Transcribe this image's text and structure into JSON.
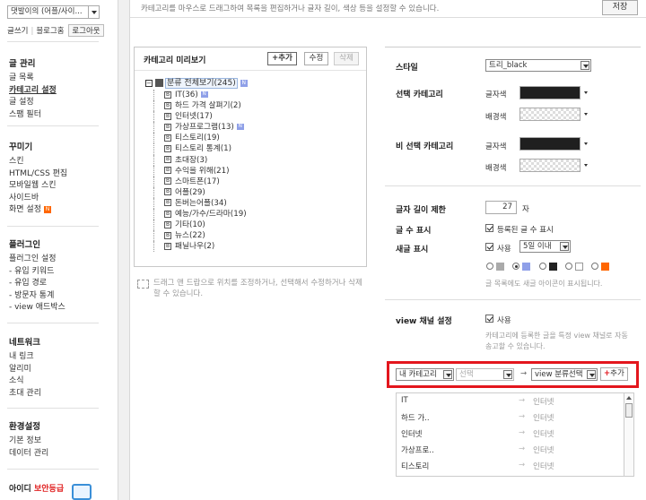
{
  "sidebar": {
    "blog_select": "댓발이의 (어플/사이...",
    "top_links": {
      "write": "글쓰기",
      "blog_home": "블로그홈",
      "logout": "로그아웃"
    },
    "sections": [
      {
        "heading": "글 관리",
        "items": [
          "글 목록",
          "카테고리 설정",
          "글 설정",
          "스팸 필터"
        ]
      },
      {
        "heading": "꾸미기",
        "items": [
          "스킨",
          "HTML/CSS 편집",
          "모바일웹 스킨",
          "사이드바",
          "화면 설정"
        ]
      },
      {
        "heading": "플러그인",
        "items": [
          "플러그인 설정",
          "- 유입 키워드",
          "- 유입 경로",
          "- 방문자 통계",
          "- view 애드박스"
        ]
      },
      {
        "heading": "네트워크",
        "items": [
          "내 링크",
          "알리미",
          "소식",
          "초대 관리"
        ]
      },
      {
        "heading": "환경설정",
        "items": [
          "기본 정보",
          "데이터 관리"
        ]
      }
    ],
    "new_badge": "N",
    "promo_prefix": "아이디 ",
    "promo_red": "보안등급"
  },
  "topbar": {
    "message": "카테고리를 마우스로 드래그하여 목록을 편집하거나 글자 길이, 색상 등을 설정할 수 있습니다.",
    "save": "저장"
  },
  "preview": {
    "title": "카테고리 미리보기",
    "add": "+추가",
    "edit": "수정",
    "delete": "삭제",
    "root": "분류 전체보기(245)",
    "items": [
      {
        "label": "IT(36)",
        "n": true
      },
      {
        "label": "하드 가격 살펴기(2)",
        "n": false
      },
      {
        "label": "인터넷(17)",
        "n": false
      },
      {
        "label": "가상프로그램(13)",
        "n": true
      },
      {
        "label": "티스토리(19)",
        "n": false
      },
      {
        "label": "티스토리 통계(1)",
        "n": false
      },
      {
        "label": "초대장(3)",
        "n": false
      },
      {
        "label": "수익을 위해(21)",
        "n": false
      },
      {
        "label": "스마트폰(17)",
        "n": false
      },
      {
        "label": "어플(29)",
        "n": false
      },
      {
        "label": "돈버는어플(34)",
        "n": false
      },
      {
        "label": "예능/가수/드라마(19)",
        "n": false
      },
      {
        "label": "기타(10)",
        "n": false
      },
      {
        "label": "뉴스(22)",
        "n": false
      },
      {
        "label": "패닐나우(2)",
        "n": false
      }
    ],
    "n_badge": "N",
    "help": "드래그 앤 드랍으로 위치를 조정하거나, 선택해서 수정하거나 삭제할 수 있습니다."
  },
  "settings": {
    "style_label": "스타일",
    "style_value": "트리_black",
    "selected_label": "선택 카테고리",
    "unselected_label": "비 선택 카테고리",
    "text_color": "글자색",
    "bg_color": "배경색",
    "length_label": "글자 길이 제한",
    "length_value": "27",
    "length_unit": "자",
    "count_label": "글 수 표시",
    "count_check": "등록된 글 수 표시",
    "new_label": "새글 표시",
    "new_check": "사용",
    "new_period": "5일 이내",
    "new_help": "글 목록에도 새글 아이콘이 표시됩니다.",
    "view_label": "view 채널 설정",
    "view_check": "사용",
    "view_help": "카테고리에 등록한 글을 특정 view 채널로 자동 송고할 수 있습니다.",
    "my_category": "내 카테고리",
    "choose": "선택",
    "view_category": "view 분류선택",
    "add": "추가",
    "arrow": "→",
    "channels": [
      {
        "from": "IT",
        "to": "인터넷"
      },
      {
        "from": "하드 가..",
        "to": "인터넷"
      },
      {
        "from": "인터넷",
        "to": "인터넷"
      },
      {
        "from": "가상프로..",
        "to": "인터넷"
      },
      {
        "from": "티스토리",
        "to": "인터넷"
      }
    ],
    "colors": {
      "highlight": "#e3161d",
      "dark_swatch": "#1f1f1f",
      "orange_badge": "#ff6600",
      "blue_badge": "#8fa0e8"
    }
  }
}
